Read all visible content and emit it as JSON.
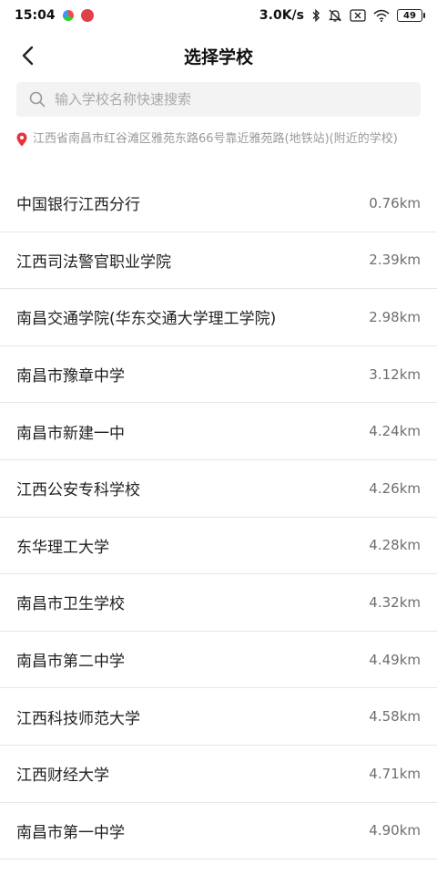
{
  "status": {
    "time": "15:04",
    "net_speed": "3.0K/s",
    "battery": "49"
  },
  "header": {
    "title": "选择学校"
  },
  "search": {
    "placeholder": "输入学校名称快速搜索"
  },
  "location": {
    "text": "江西省南昌市红谷滩区雅苑东路66号靠近雅苑路(地铁站)(附近的学校)"
  },
  "schools": [
    {
      "name": "中国银行江西分行",
      "distance": "0.76km"
    },
    {
      "name": "江西司法警官职业学院",
      "distance": "2.39km"
    },
    {
      "name": "南昌交通学院(华东交通大学理工学院)",
      "distance": "2.98km"
    },
    {
      "name": "南昌市豫章中学",
      "distance": "3.12km"
    },
    {
      "name": "南昌市新建一中",
      "distance": "4.24km"
    },
    {
      "name": "江西公安专科学校",
      "distance": "4.26km"
    },
    {
      "name": "东华理工大学",
      "distance": "4.28km"
    },
    {
      "name": "南昌市卫生学校",
      "distance": "4.32km"
    },
    {
      "name": "南昌市第二中学",
      "distance": "4.49km"
    },
    {
      "name": "江西科技师范大学",
      "distance": "4.58km"
    },
    {
      "name": "江西财经大学",
      "distance": "4.71km"
    },
    {
      "name": "南昌市第一中学",
      "distance": "4.90km"
    }
  ],
  "colors": {
    "pin": "#e8333a",
    "divider": "#e6e6e6"
  },
  "icons": {
    "back": "chevron-left-icon",
    "search": "search-icon",
    "location": "location-pin-icon"
  }
}
